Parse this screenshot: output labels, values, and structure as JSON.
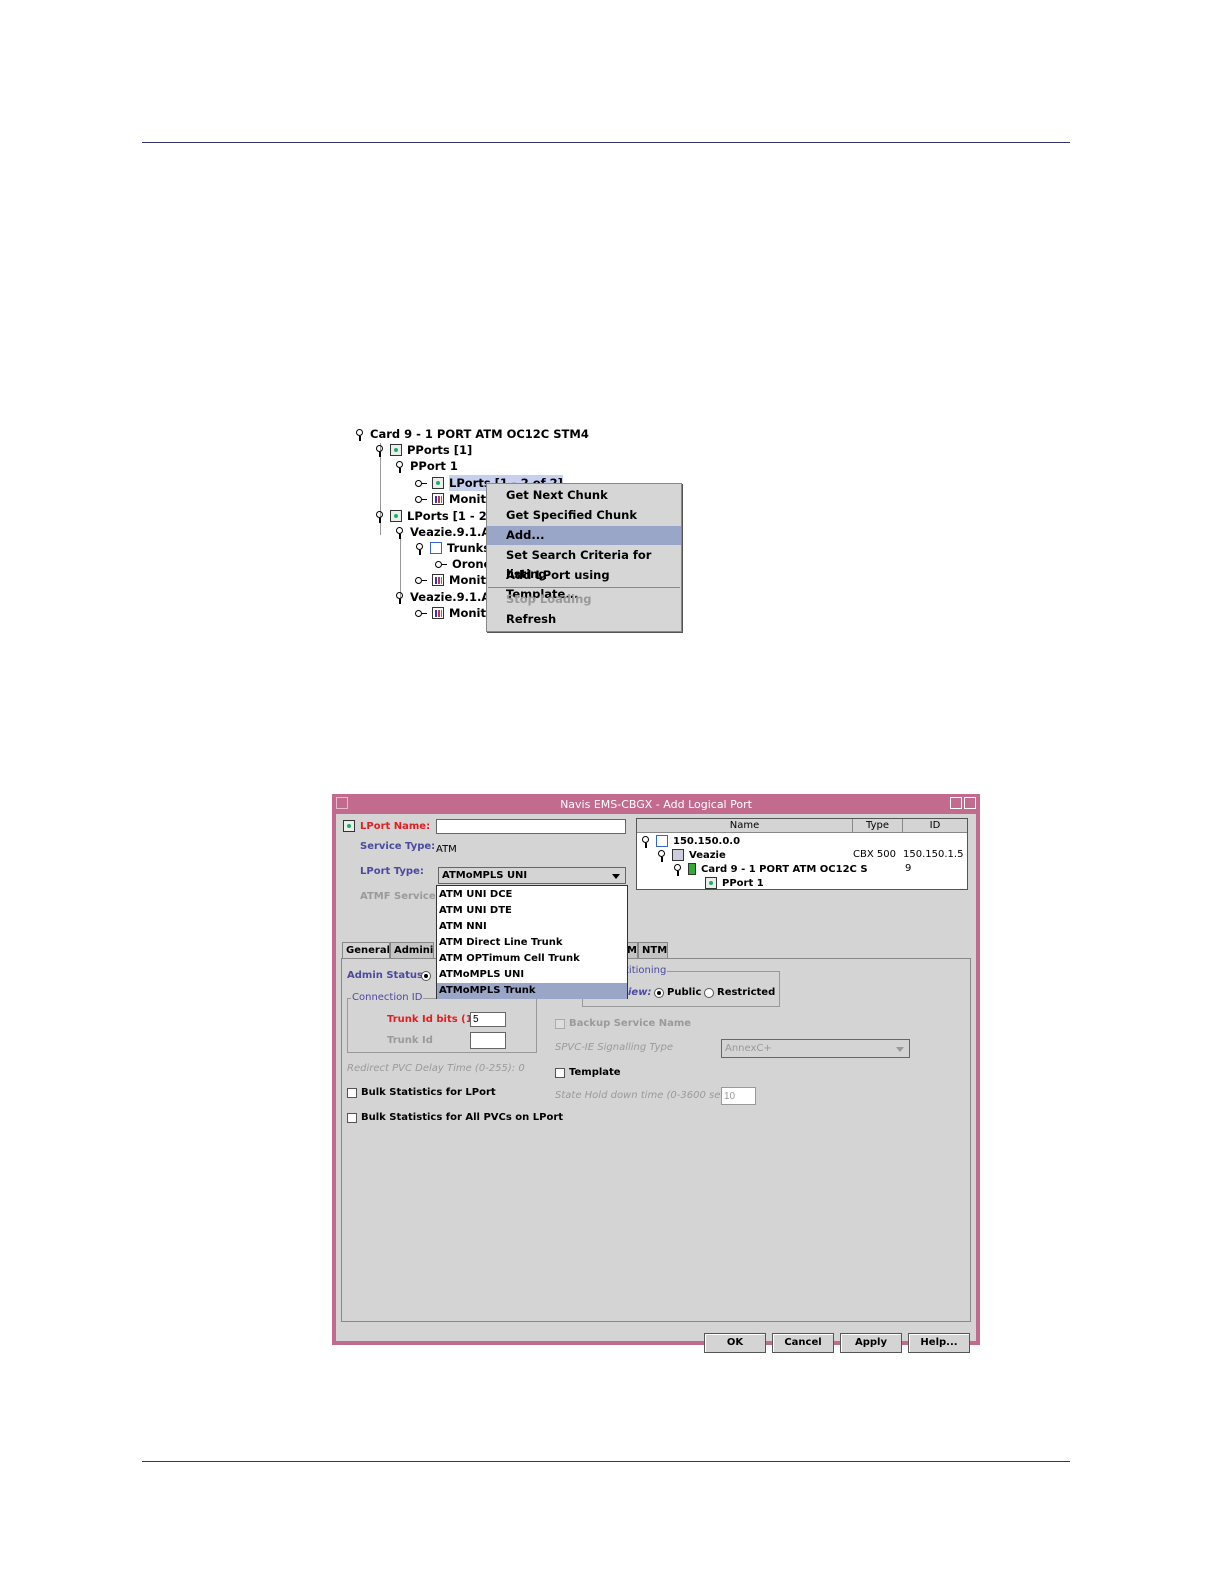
{
  "tree": {
    "items": [
      "Card 9 - 1 PORT ATM OC12C STM4",
      "PPorts [1]",
      "PPort 1",
      "LPorts [1 - 2 of 2]",
      "Monitor",
      "LPorts [1 - 2 of",
      "Veazie.9.1.ATM",
      "Trunks",
      "Orono.9",
      "Monitor",
      "Veazie.9.1.ATM",
      "Monitor"
    ]
  },
  "context_menu": {
    "items": [
      "Get Next Chunk",
      "Get Specified Chunk",
      "Add...",
      "Set Search Criteria for listing",
      "Add LPort using Template...",
      "Stop Loading",
      "Refresh"
    ]
  },
  "dialog": {
    "title": "Navis EMS-CBGX - Add Logical Port",
    "lport_name_label": "LPort Name:",
    "lport_name_value": "",
    "service_type_label": "Service Type:",
    "service_type_value": "ATM",
    "lport_type_label": "LPort Type:",
    "lport_type_value": "ATMoMPLS UNI",
    "atmf_services_label": "ATMF Services",
    "lport_type_options": [
      "ATM UNI DCE",
      "ATM UNI DTE",
      "ATM NNI",
      "ATM Direct Line Trunk",
      "ATM OPTimum Cell Trunk",
      "ATMoMPLS UNI",
      "ATMoMPLS Trunk"
    ],
    "table": {
      "headers": [
        "Name",
        "Type",
        "ID"
      ],
      "rows": [
        {
          "name": "150.150.0.0",
          "type": "",
          "id": ""
        },
        {
          "name": "Veazie",
          "type": "CBX 500",
          "id": "150.150.1.5"
        },
        {
          "name": "Card 9 - 1 PORT ATM OC12C S",
          "type": "",
          "id": "9"
        },
        {
          "name": "PPort 1",
          "type": "",
          "id": ""
        }
      ]
    },
    "tabs": [
      "General",
      "Administ",
      "M",
      "NTM"
    ],
    "admin_status_label": "Admin Status:",
    "connection_id_label": "Connection ID",
    "trunk_id_bits_label": "Trunk Id bits (1-5)",
    "trunk_id_bits_value": "5",
    "trunk_id_label": "Trunk Id",
    "trunk_id_value": "",
    "redirect_pvc_label": "Redirect PVC Delay Time (0-255):",
    "redirect_pvc_value": "0",
    "bulk_stats_lport_label": "Bulk Statistics for LPort",
    "bulk_stats_pvcs_label": "Bulk Statistics for All PVCs on LPort",
    "partitioning_label": "titioning",
    "view_label": "iew:",
    "public_label": "Public",
    "restricted_label": "Restricted",
    "backup_service_label": "Backup Service Name",
    "spvc_label": "SPVC-IE Signalling Type",
    "spvc_value": "AnnexC+",
    "template_label": "Template",
    "state_hold_label": "State Hold down time (0-3600 sec)",
    "state_hold_value": "10",
    "buttons": {
      "ok": "OK",
      "cancel": "Cancel",
      "apply": "Apply",
      "help": "Help..."
    }
  }
}
